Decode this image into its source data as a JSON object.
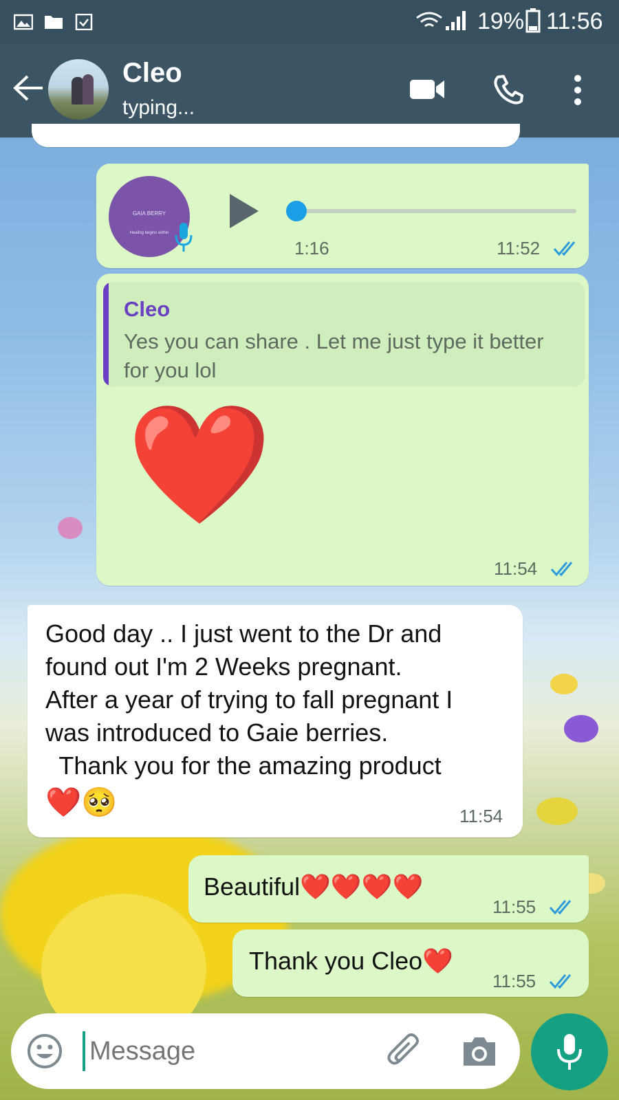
{
  "status_bar": {
    "signal_text": "19%",
    "battery_icon": "battery-icon",
    "time": "11:56",
    "left_icons": [
      "gallery-icon",
      "folder-icon",
      "download-check-icon"
    ]
  },
  "header": {
    "contact_name": "Cleo",
    "contact_status": "typing...",
    "back_icon": "back-arrow-icon",
    "video_icon": "video-call-icon",
    "call_icon": "phone-call-icon",
    "menu_icon": "more-vert-icon"
  },
  "messages": {
    "voice": {
      "duration": "1:16",
      "time": "11:52",
      "avatar_brand": "GAIA BERRY",
      "avatar_tagline": "Healing begins within",
      "progress": 0.0
    },
    "reply": {
      "quoted_author": "Cleo",
      "quoted_text": "Yes you can share . Let me just type it better for you lol",
      "body": "❤️",
      "time": "11:54"
    },
    "incoming": {
      "line1": "Good day .. I just went to the Dr and",
      "line2": "found out I'm 2 Weeks pregnant.",
      "line3": "After a year of trying to fall pregnant I",
      "line4": "was introduced to Gaie berries.",
      "line5": "  Thank you for the amazing product",
      "line6": "❤️🥺",
      "time": "11:54"
    },
    "out1": {
      "text": "Beautiful❤️❤️❤️❤️",
      "time": "11:55"
    },
    "out2": {
      "text": "Thank you Cleo❤️",
      "time": "11:55"
    }
  },
  "composer": {
    "placeholder": "Message",
    "emoji_icon": "emoji-icon",
    "attach_icon": "paperclip-icon",
    "camera_icon": "camera-icon",
    "mic_icon": "mic-icon"
  },
  "colors": {
    "header": "#3b5565",
    "outgoing_bubble": "#dcf8c6",
    "incoming_bubble": "#ffffff",
    "accent": "#15a083",
    "read_ticks": "#2c9bdc",
    "quote_bar": "#6a3fc4"
  }
}
